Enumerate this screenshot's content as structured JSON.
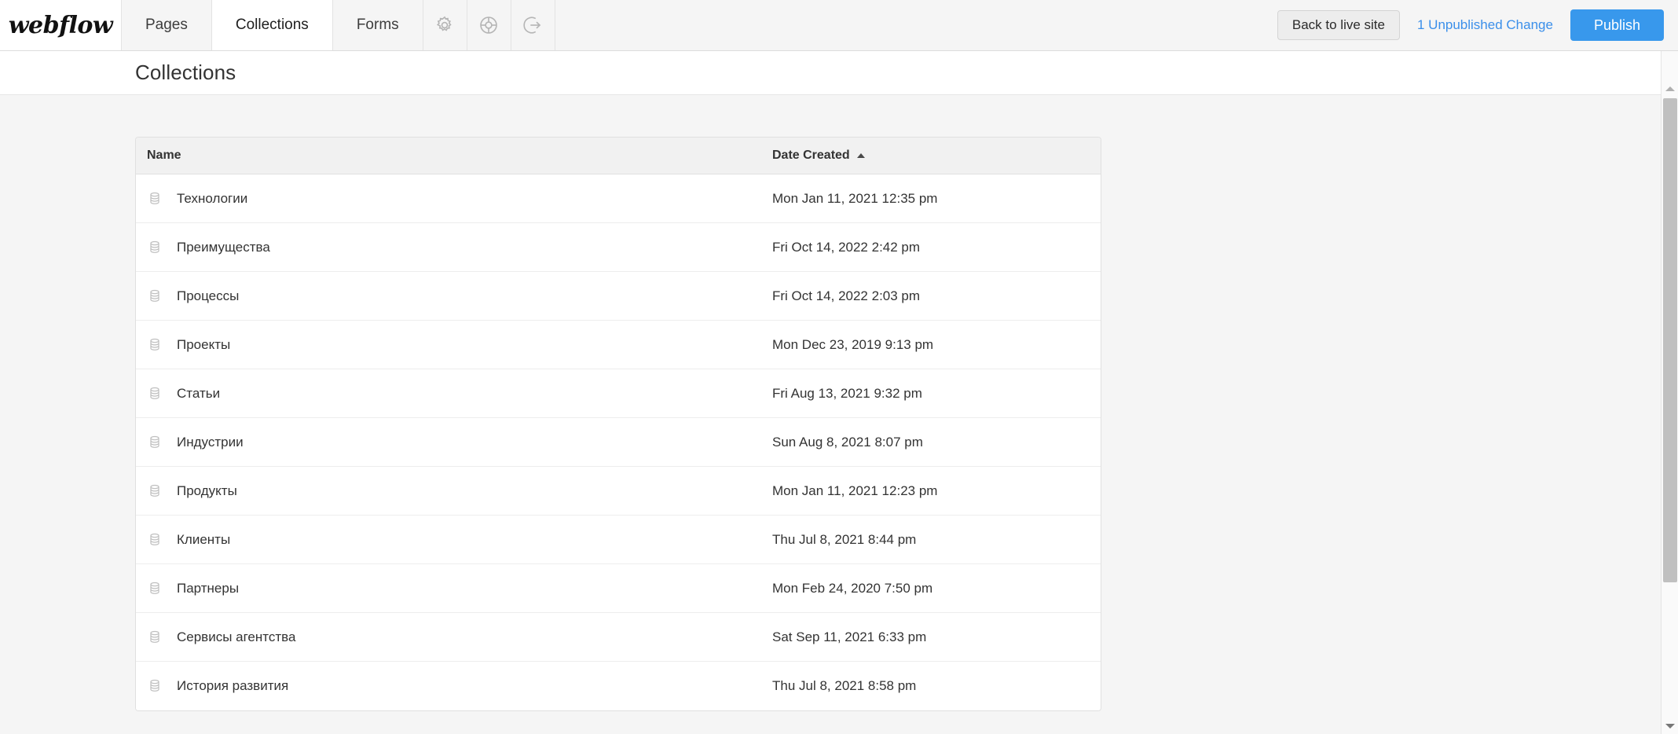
{
  "app": {
    "brand": "webflow",
    "page_title": "Collections"
  },
  "topnav": {
    "tabs": [
      {
        "label": "Pages",
        "icon": "",
        "active": false
      },
      {
        "label": "Collections",
        "icon": "",
        "active": true
      },
      {
        "label": "Forms",
        "icon": "",
        "active": false
      }
    ],
    "icon_buttons": [
      {
        "name": "gear-icon",
        "title": "Settings"
      },
      {
        "name": "life-ring-icon",
        "title": "Help"
      },
      {
        "name": "circle-arrow-out-icon",
        "title": "Open site"
      }
    ],
    "back_to_live_site": "Back to live site",
    "unpublished_changes": "1 Unpublished Change",
    "publish": "Publish",
    "accent_color": "#3898ec",
    "link_color": "#3b8fea"
  },
  "table": {
    "columns": {
      "name": "Name",
      "date_created": "Date Created"
    },
    "sort": {
      "column": "Date Created",
      "direction": "asc",
      "caret": "▲"
    },
    "rows": [
      {
        "icon": "collection-database-icon",
        "name": "Технологии",
        "date_created": "Mon Jan 11, 2021 12:35 pm"
      },
      {
        "icon": "collection-database-icon",
        "name": "Преимущества",
        "date_created": "Fri Oct 14, 2022 2:42 pm"
      },
      {
        "icon": "collection-database-icon",
        "name": "Процессы",
        "date_created": "Fri Oct 14, 2022 2:03 pm"
      },
      {
        "icon": "collection-database-icon",
        "name": "Проекты",
        "date_created": "Mon Dec 23, 2019 9:13 pm"
      },
      {
        "icon": "collection-database-icon",
        "name": "Статьи",
        "date_created": "Fri Aug 13, 2021 9:32 pm"
      },
      {
        "icon": "collection-database-icon",
        "name": "Индустрии",
        "date_created": "Sun Aug 8, 2021 8:07 pm"
      },
      {
        "icon": "collection-database-icon",
        "name": "Продукты",
        "date_created": "Mon Jan 11, 2021 12:23 pm"
      },
      {
        "icon": "collection-database-icon",
        "name": "Клиенты",
        "date_created": "Thu Jul 8, 2021 8:44 pm"
      },
      {
        "icon": "collection-database-icon",
        "name": "Партнеры",
        "date_created": "Mon Feb 24, 2020 7:50 pm"
      },
      {
        "icon": "collection-database-icon",
        "name": "Сервисы агентства",
        "date_created": "Sat Sep 11, 2021 6:33 pm"
      },
      {
        "icon": "collection-database-icon",
        "name": "История развития",
        "date_created": "Thu Jul 8, 2021 8:58 pm"
      }
    ]
  },
  "scrollbar": {
    "up_arrow": "▲",
    "down_arrow": "▼"
  }
}
